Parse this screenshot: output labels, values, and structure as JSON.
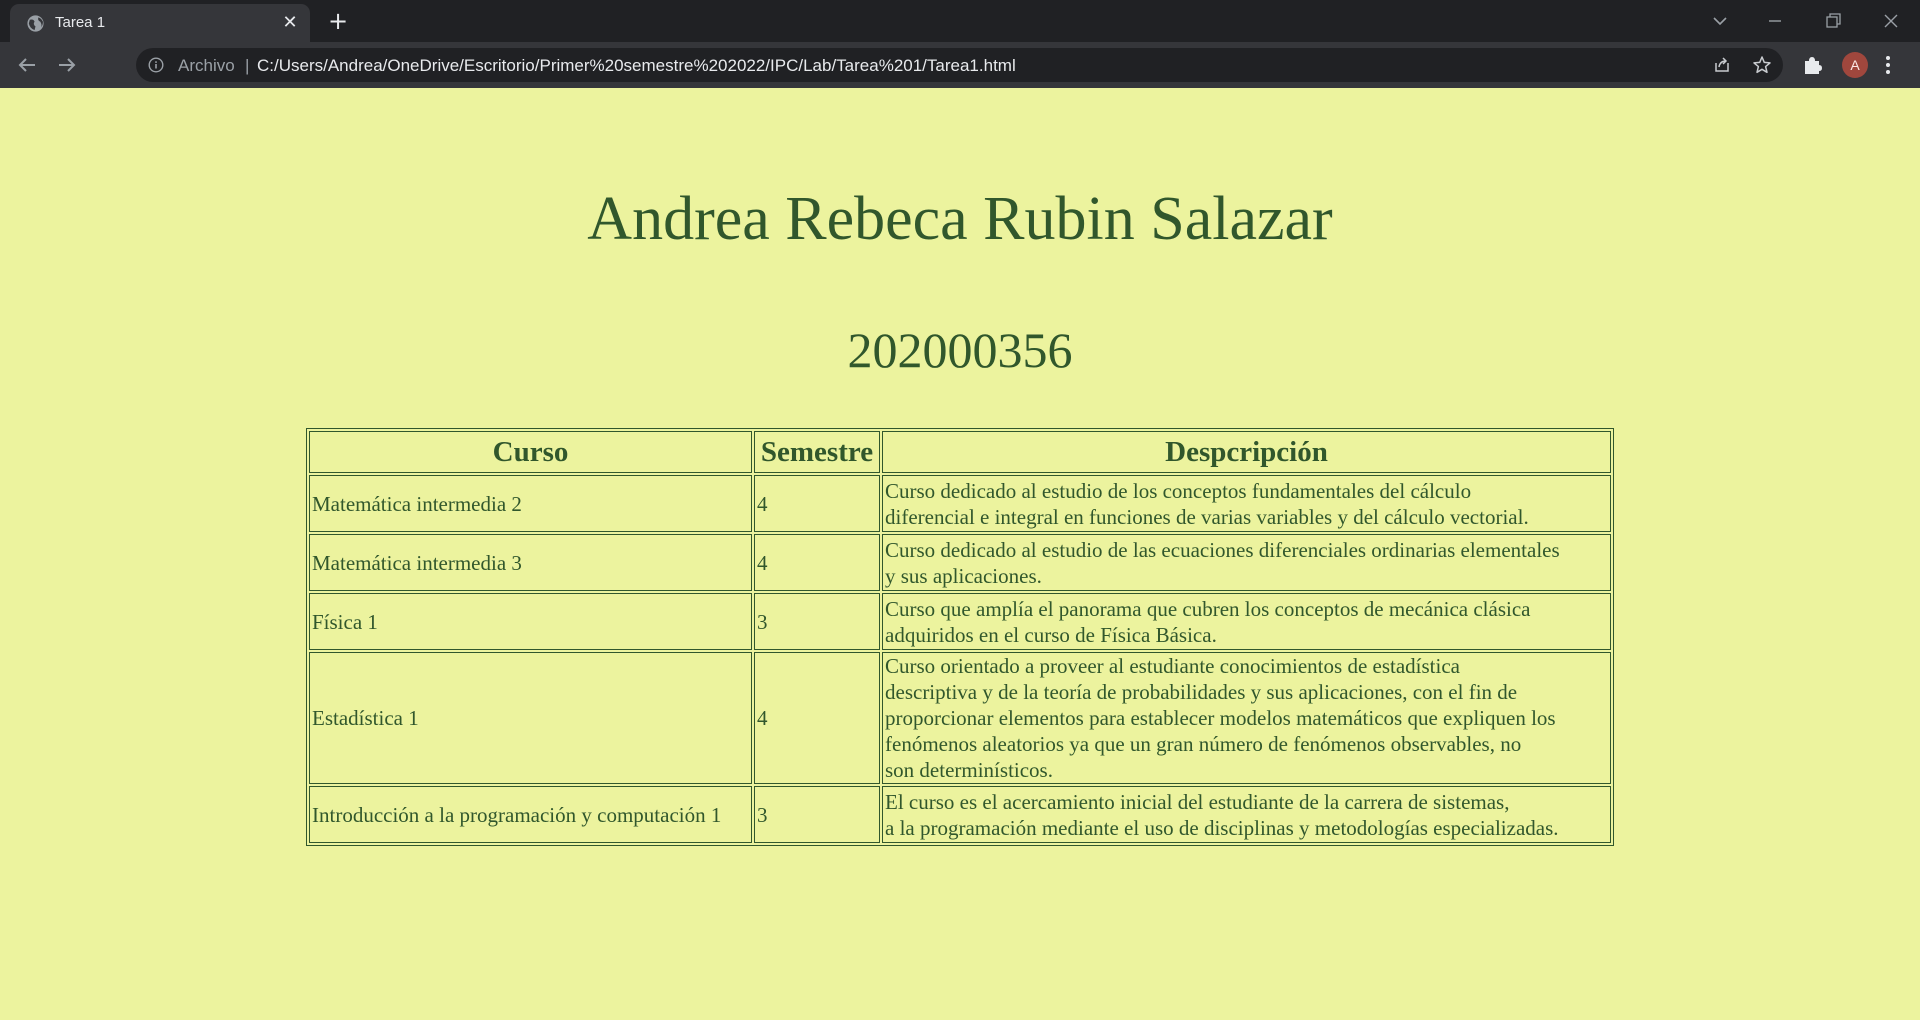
{
  "browser": {
    "tab_title": "Tarea 1",
    "scheme_label": "Archivo",
    "separator": "|",
    "url": "C:/Users/Andrea/OneDrive/Escritorio/Primer%20semestre%202022/IPC/Lab/Tarea%201/Tarea1.html",
    "profile_initial": "A",
    "icons": [
      "globe-icon",
      "close-icon",
      "plus-icon",
      "back-arrow-icon",
      "forward-arrow-icon",
      "info-icon",
      "share-icon",
      "star-icon",
      "puzzle-icon",
      "kebab-menu-icon",
      "minimize-icon",
      "restore-icon",
      "window-close-icon",
      "chevron-down-icon"
    ]
  },
  "page": {
    "name": "Andrea Rebeca Rubin Salazar",
    "carne": "202000356",
    "colors": {
      "background": "#ecf39e",
      "text": "#31572c"
    },
    "table": {
      "headers": [
        "Curso",
        "Semestre",
        "Despcripción"
      ],
      "rows": [
        {
          "curso": "Matemática intermedia 2",
          "semestre": "4",
          "descripcion": [
            "Curso dedicado al estudio de los conceptos fundamentales del cálculo",
            "diferencial e integral en funciones de varias variables y del cálculo vectorial."
          ]
        },
        {
          "curso": "Matemática intermedia 3",
          "semestre": "4",
          "descripcion": [
            "Curso dedicado al estudio de las ecuaciones diferenciales ordinarias elementales",
            "y sus aplicaciones."
          ]
        },
        {
          "curso": "Física 1",
          "semestre": "3",
          "descripcion": [
            "Curso que amplía el panorama que cubren los conceptos de mecánica clásica",
            "adquiridos en el curso de Física Básica."
          ]
        },
        {
          "curso": "Estadística 1",
          "semestre": "4",
          "descripcion": [
            "Curso orientado a proveer al estudiante conocimientos de estadística",
            "descriptiva y de la teoría de probabilidades y sus aplicaciones, con el fin de",
            "proporcionar elementos para establecer modelos matemáticos que expliquen los",
            "fenómenos aleatorios ya que un gran número de fenómenos observables, no",
            "son determinísticos."
          ]
        },
        {
          "curso": "Introducción a la programación y computación 1",
          "semestre": "3",
          "descripcion": [
            "El curso es el acercamiento inicial del estudiante de la carrera de sistemas,",
            "a la programación mediante el uso de disciplinas y metodologías especializadas."
          ]
        }
      ]
    }
  }
}
